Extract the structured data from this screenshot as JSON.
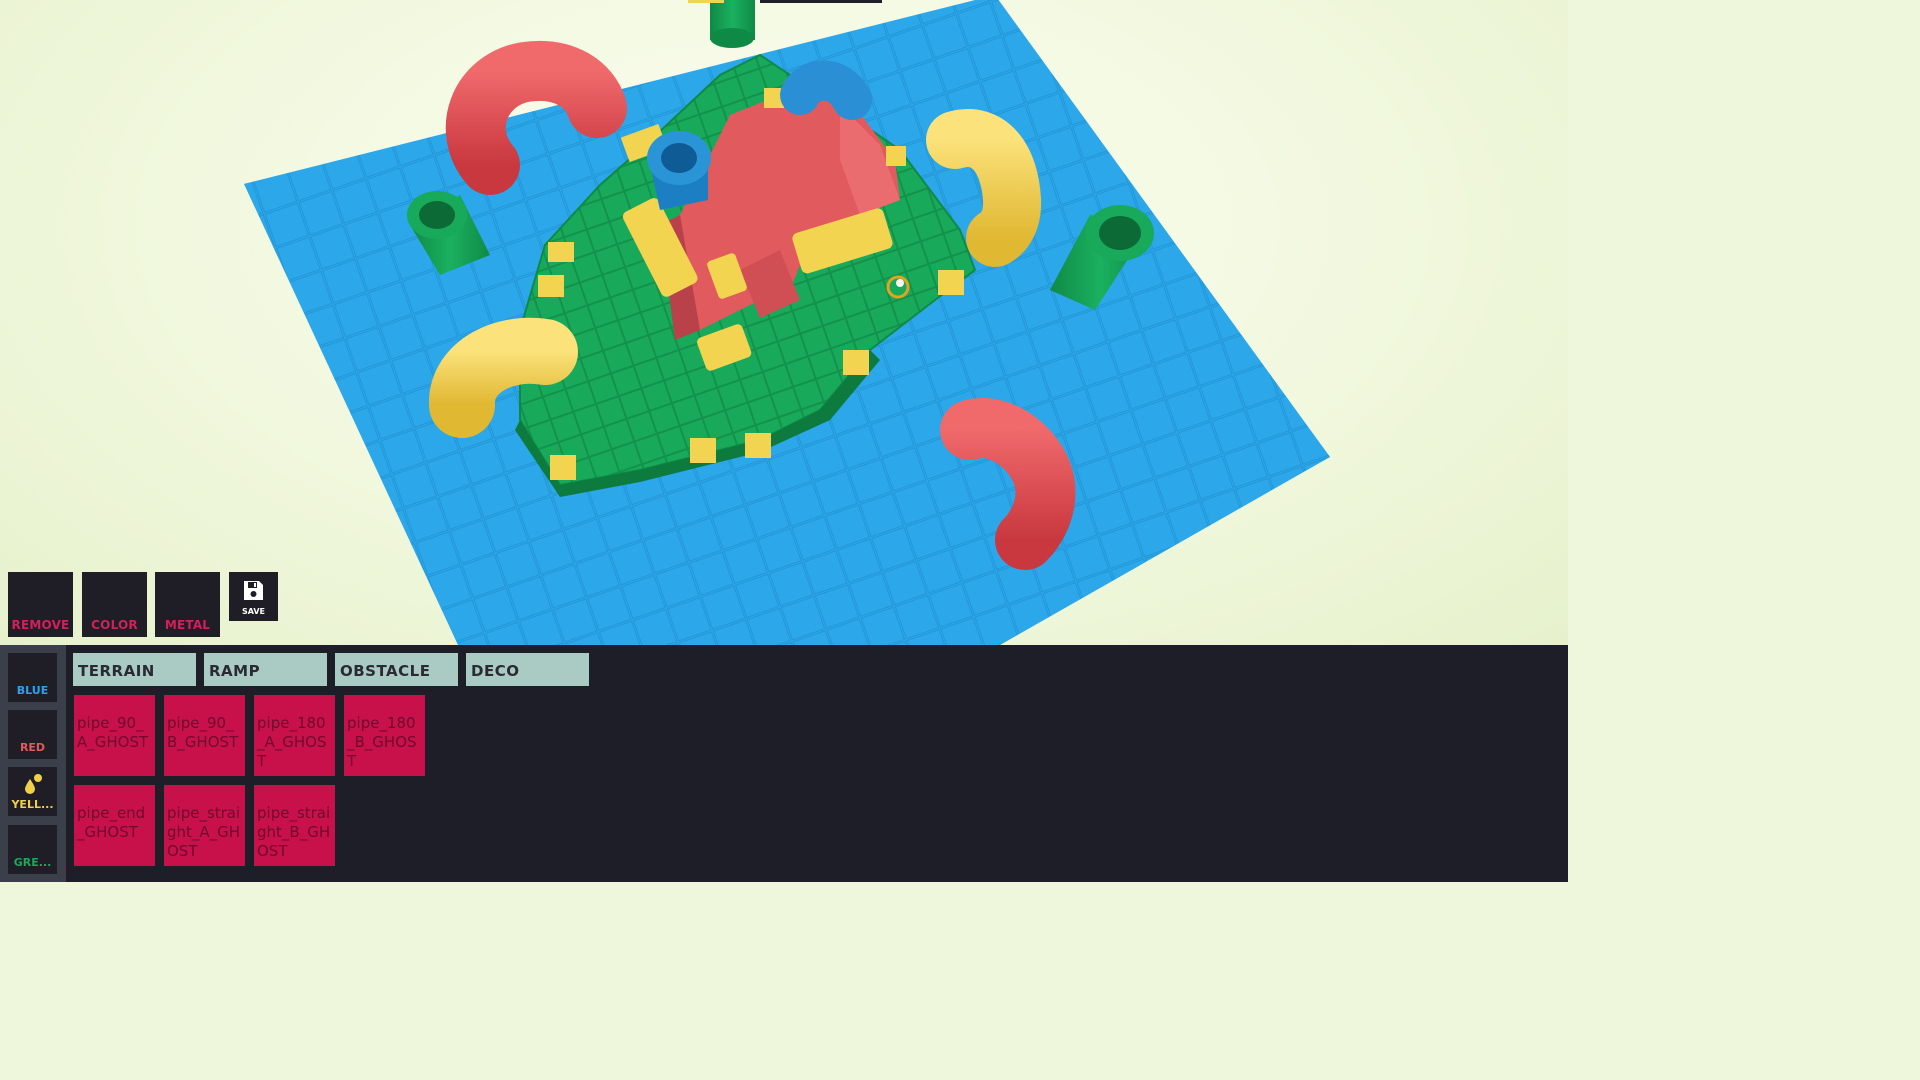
{
  "toolbar": {
    "remove_label": "REMOVE",
    "color_label": "COLOR",
    "metal_label": "METAL",
    "save_label": "SAVE"
  },
  "colors_panel": [
    {
      "label": "BLUE",
      "color": "#2aa4e8"
    },
    {
      "label": "RED",
      "color": "#e05a5e"
    },
    {
      "label": "YELL...",
      "color": "#f0d04a"
    },
    {
      "label": "GRE...",
      "color": "#19a95a"
    }
  ],
  "category_tabs": [
    "TERRAIN",
    "RAMP",
    "OBSTACLE",
    "DECO"
  ],
  "items": [
    "pipe_90_A_GHOST",
    "pipe_90_B_GHOST",
    "pipe_180_A_GHOST",
    "pipe_180_B_GHOST",
    "pipe_end_GHOST",
    "pipe_straight_A_GHOST",
    "pipe_straight_B_GHOST"
  ],
  "theme": {
    "panel_bg": "#1e1e28",
    "tile_bg": "#c8114b",
    "tab_bg": "#a9cbc4",
    "accent_pink": "#d41f5a",
    "water_blue": "#2aa4e8",
    "grass_green": "#19a95a",
    "block_red": "#e05a5e",
    "block_yellow": "#f0d04a"
  }
}
